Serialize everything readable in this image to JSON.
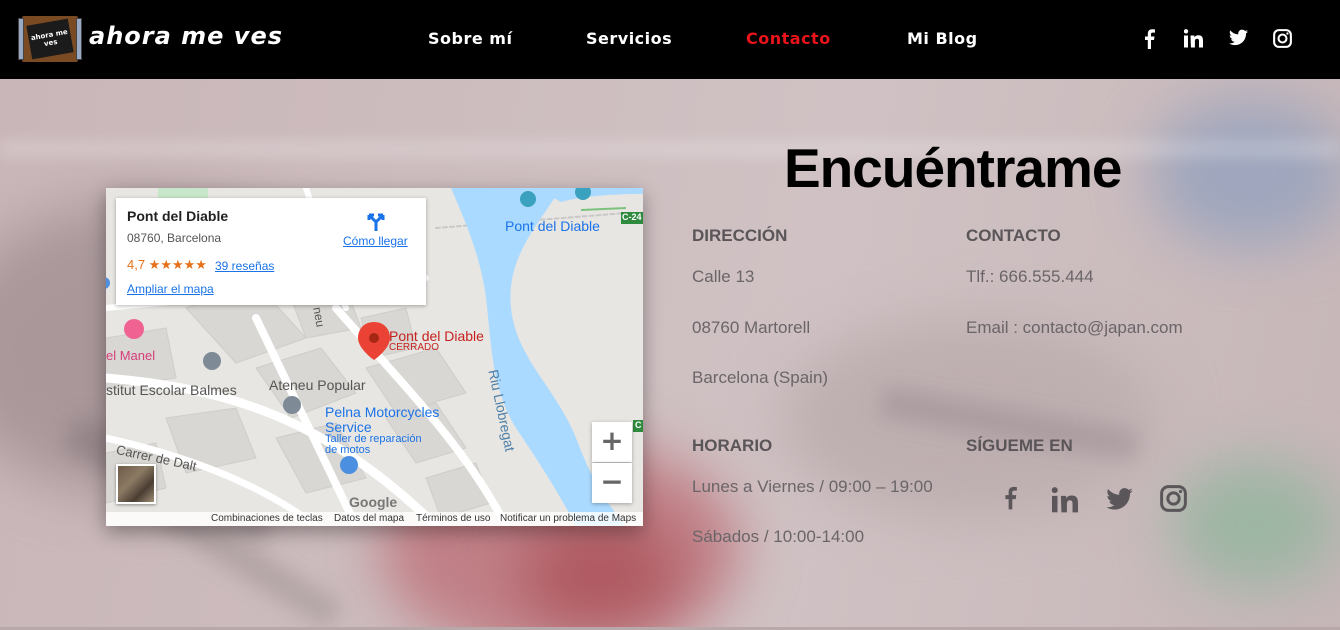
{
  "header": {
    "logo_text": "ahora me ves",
    "brand": "ahora me ves",
    "nav": [
      {
        "label": "Sobre mí"
      },
      {
        "label": "Servicios"
      },
      {
        "label": "Contacto"
      },
      {
        "label": "Mi Blog"
      }
    ],
    "social": [
      "facebook-icon",
      "linkedin-icon",
      "twitter-icon",
      "instagram-icon"
    ],
    "accent_color": "#e8141a"
  },
  "map": {
    "place_name": "Pont del Diable",
    "address": "08760, Barcelona",
    "rating": "4,7 ★★★★★",
    "reviews": "39 reseñas",
    "enlarge_link": "Ampliar el mapa",
    "directions_label": "Cómo llegar",
    "pin_label": "Pont del Diable",
    "pin_status": "CERRADO",
    "labels": {
      "bridge_top": "Pont del Diable",
      "road": "C-24",
      "road_c": "C",
      "river": "Riu Llobregat",
      "manel": "el Manel",
      "school": "stitut Escolar Balmes",
      "ateneu": "Ateneu Popular",
      "moto_name_1": "Pelna Motorcycles",
      "moto_name_2": "Service",
      "moto_desc_1": "Taller de reparación",
      "moto_desc_2": "de motos",
      "street": "Carrer de Dalt",
      "street_top": "neu",
      "google": "Google"
    },
    "zoom_in": "+",
    "zoom_out": "−",
    "attribution": {
      "shortcuts": "Combinaciones de teclas",
      "data": "Datos del mapa",
      "terms": "Términos de uso",
      "report": "Notificar un problema de Maps"
    }
  },
  "contact": {
    "title": "Encuéntrame",
    "address_heading": "DIRECCIÓN",
    "address_lines": [
      "Calle 13",
      "08760 Martorell",
      "Barcelona (Spain)"
    ],
    "contact_heading": "CONTACTO",
    "phone": "Tlf.: 666.555.444",
    "email": "Email : contacto@japan.com",
    "hours_heading": "HORARIO",
    "hours_lines": [
      "Lunes a Viernes / 09:00 – 19:00",
      "Sábados / 10:00-14:00"
    ],
    "follow_heading": "SÍGUEME EN",
    "follow_icons": [
      "facebook-icon",
      "linkedin-icon",
      "twitter-icon",
      "instagram-icon"
    ]
  }
}
